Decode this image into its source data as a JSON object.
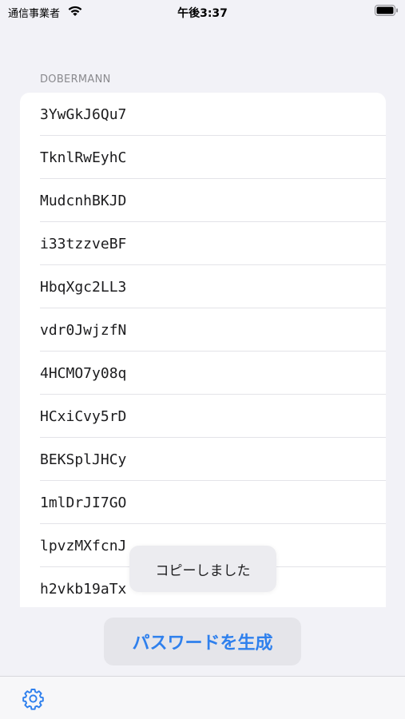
{
  "status_bar": {
    "carrier": "通信事業者",
    "time": "午後3:37"
  },
  "section": {
    "header": "DOBERMANN"
  },
  "passwords": [
    "3YwGkJ6Qu7",
    "TknlRwEyhC",
    "MudcnhBKJD",
    "i33tzzveBF",
    "HbqXgc2LL3",
    "vdr0JwjzfN",
    "4HCMO7y08q",
    "HCxiCvy5rD",
    "BEKSplJHCy",
    "1mlDrJI7GO",
    "lpvzMXfcnJ",
    "h2vkb19aTx"
  ],
  "toast": {
    "message": "コピーしました"
  },
  "actions": {
    "generate_label": "パスワードを生成"
  },
  "toolbar": {
    "settings_icon": "gear-icon"
  },
  "colors": {
    "accent": "#2f80ed",
    "background": "#f2f2f7"
  }
}
